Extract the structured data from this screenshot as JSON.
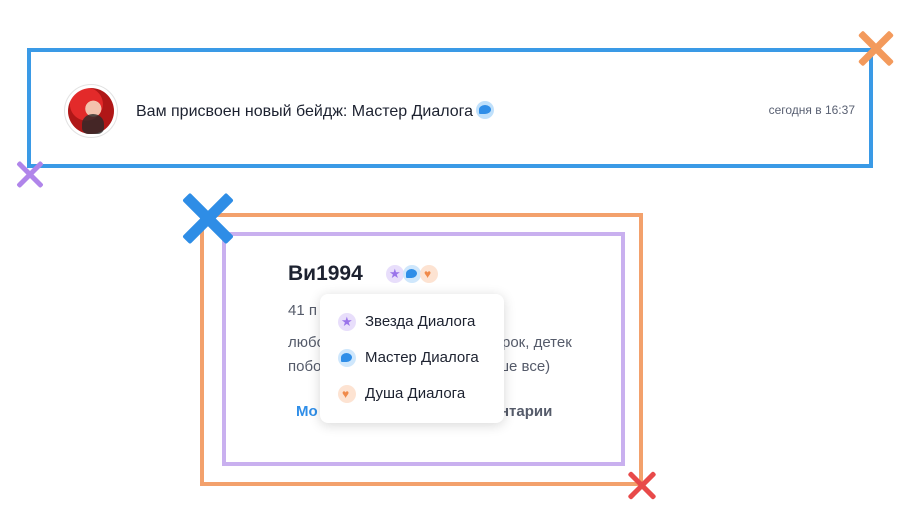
{
  "notification": {
    "text": "Вам присвоен новый бейдж: Мастер Диалога",
    "badge_icon": "chat-bubble-icon",
    "time": "сегодня в 16:37"
  },
  "profile": {
    "username": "Ви1994",
    "badges": [
      "star-badge-icon",
      "chat-badge-icon",
      "heart-badge-icon"
    ],
    "stats_partial": "41 п",
    "bio_line1_left": "любо",
    "bio_line1_right": "рок, детек",
    "bio_line2_left": "побо",
    "bio_line2_right": "ше все)",
    "link_left_partial": "Мо",
    "link_right_partial": "нтарии"
  },
  "badge_dropdown": {
    "items": [
      {
        "label": "Звезда Диалога",
        "icon": "star-icon"
      },
      {
        "label": "Мастер Диалога",
        "icon": "chat-icon"
      },
      {
        "label": "Душа Диалога",
        "icon": "heart-icon"
      }
    ]
  },
  "colors": {
    "notification_frame": "#3a9ae6",
    "outer_frame": "#f3a16c",
    "inner_frame": "#c9b0ef",
    "x_orange": "#f39a5c",
    "x_purple": "#b085ea",
    "x_blue": "#2e8de6",
    "x_red": "#e84a4a",
    "link_blue": "#2f8ee8"
  }
}
